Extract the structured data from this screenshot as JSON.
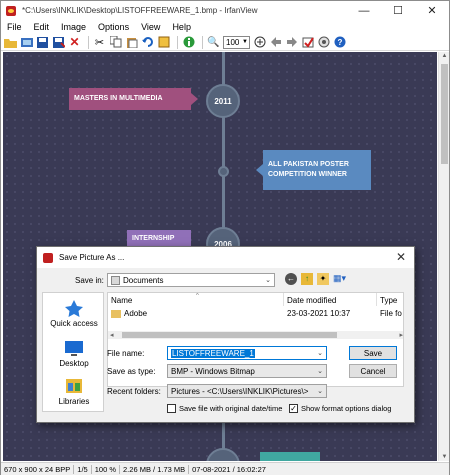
{
  "window": {
    "title": "*C:\\Users\\INKLIK\\Desktop\\LISTOFFREEWARE_1.bmp - IrfanView",
    "controls": [
      "—",
      "☐",
      "✕"
    ]
  },
  "menu": [
    "File",
    "Edit",
    "Image",
    "Options",
    "View",
    "Help"
  ],
  "toolbar": {
    "zoom_value": "100"
  },
  "canvas": {
    "year_2011": "2011",
    "year_2006": "2006",
    "card_masters": "MASTERS IN MULTIMEDIA",
    "card_pakistan": "ALL PAKISTAN POSTER COMPETITION WINNER",
    "card_internship": "INTERNSHIP"
  },
  "status": {
    "dims": "670 x 900 x 24 BPP",
    "page": "1/5",
    "zoom": "100 %",
    "size": "2.26 MB / 1.73 MB",
    "date": "07-08-2021 / 16:02:27"
  },
  "dialog": {
    "title": "Save Picture As ...",
    "save_in_label": "Save in:",
    "save_in_value": "Documents",
    "places": [
      "Quick access",
      "Desktop",
      "Libraries"
    ],
    "columns": [
      "Name",
      "Date modified",
      "Type"
    ],
    "files": [
      {
        "name": "Adobe",
        "date": "23-03-2021 10:37",
        "type": "File fo"
      }
    ],
    "filename_label": "File name:",
    "filename_value": "LISTOFFREEWARE_1",
    "saveas_label": "Save as type:",
    "saveas_value": "BMP - Windows Bitmap",
    "recent_label": "Recent folders:",
    "recent_value": "Pictures  -  <C:\\Users\\INKLIK\\Pictures\\>",
    "save_button": "Save",
    "cancel_button": "Cancel",
    "chk_original_date": "Save file with original date/time",
    "chk_format_options": "Show format options dialog",
    "chk_original_date_checked": false,
    "chk_format_options_checked": true
  }
}
